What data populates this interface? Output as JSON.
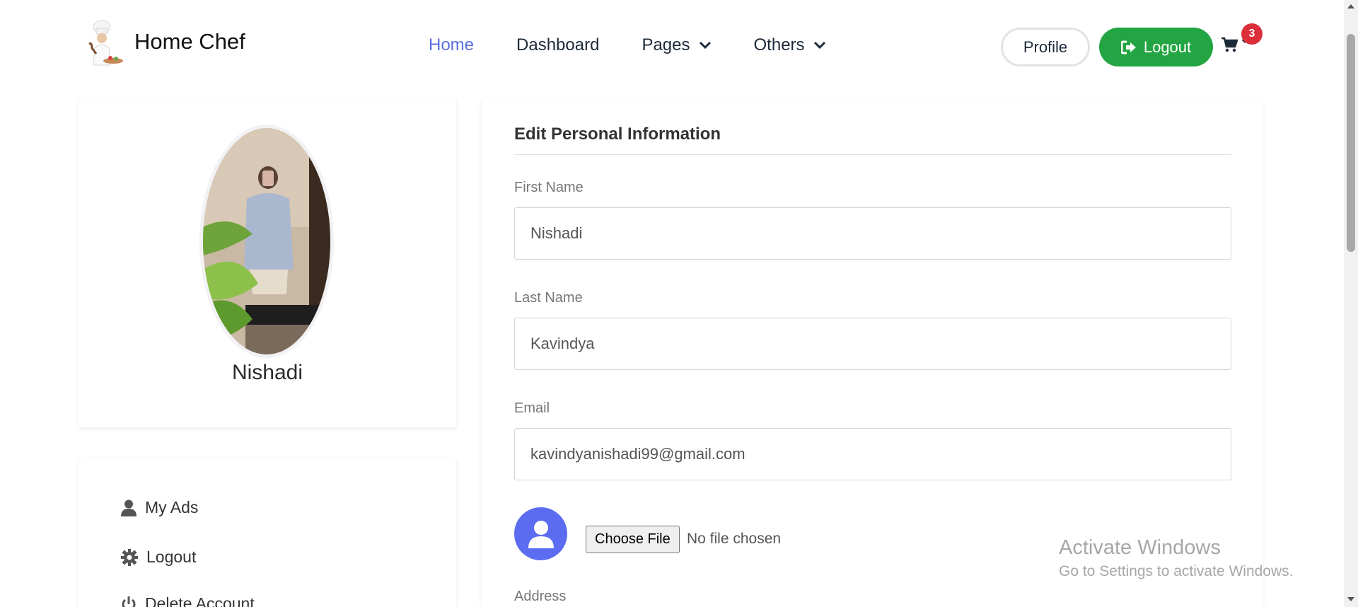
{
  "brand": {
    "name": "Home Chef",
    "logo_icon": "chef-logo-icon"
  },
  "nav": {
    "items": [
      {
        "label": "Home",
        "active": true
      },
      {
        "label": "Dashboard"
      },
      {
        "label": "Pages",
        "dropdown": true
      },
      {
        "label": "Others",
        "dropdown": true
      }
    ],
    "profile_label": "Profile",
    "logout_label": "Logout",
    "cart_count": "3"
  },
  "profile": {
    "name": "Nishadi"
  },
  "menu": {
    "items": [
      {
        "label": "My Ads",
        "icon": "user-icon"
      },
      {
        "label": "Logout",
        "icon": "gear-icon"
      },
      {
        "label": "Delete Account",
        "icon": "power-icon"
      }
    ]
  },
  "form": {
    "title": "Edit Personal Information",
    "first_name": {
      "label": "First Name",
      "value": "Nishadi"
    },
    "last_name": {
      "label": "Last Name",
      "value": "Kavindya"
    },
    "email": {
      "label": "Email",
      "value": "kavindyanishadi99@gmail.com"
    },
    "file": {
      "button": "Choose File",
      "status": "No file chosen"
    },
    "address": {
      "label": "Address"
    }
  },
  "watermark": {
    "title": "Activate Windows",
    "subtitle": "Go to Settings to activate Windows."
  },
  "colors": {
    "accent": "#5c6fe0",
    "logout": "#22a542",
    "badge": "#dc2f3c",
    "avatar_bg": "#5b6cf0"
  }
}
